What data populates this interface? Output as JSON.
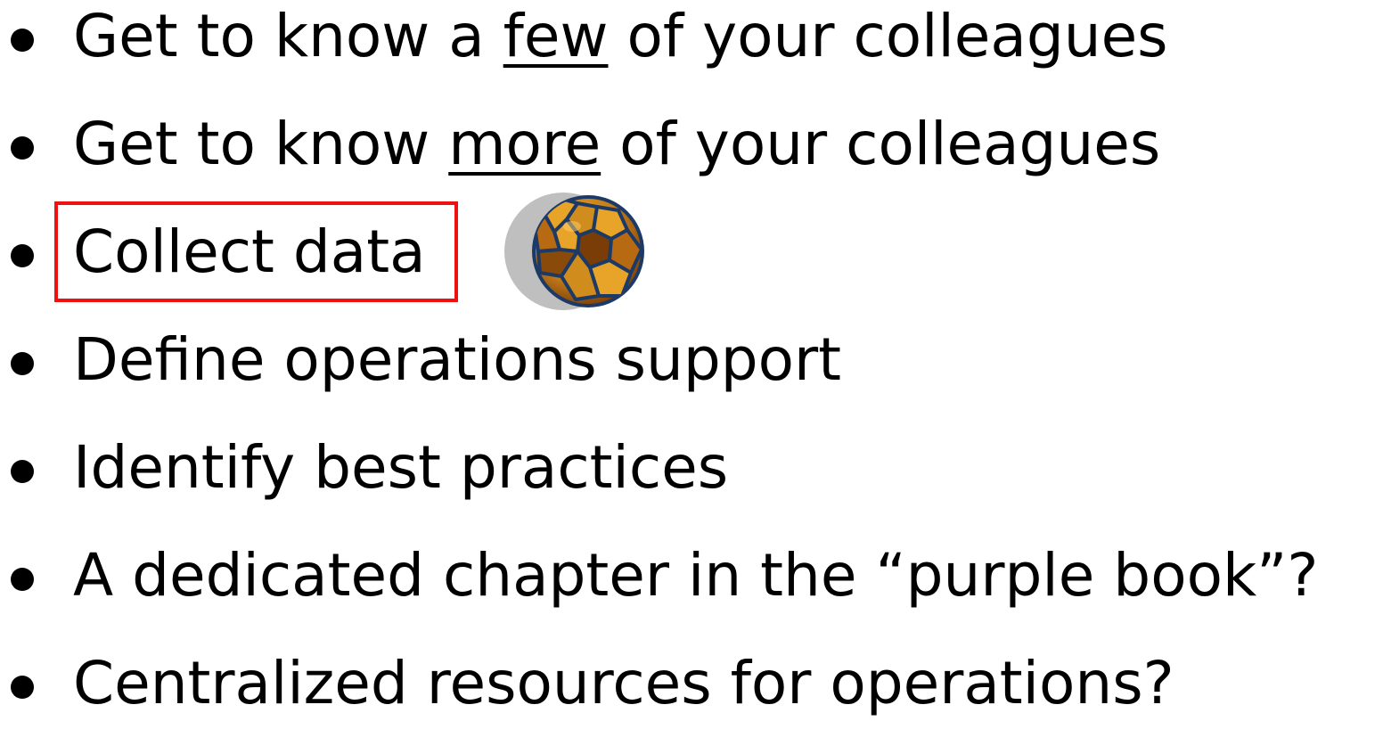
{
  "bullets": [
    {
      "pre": "Get to know a ",
      "emph": "few",
      "post": " of your colleagues"
    },
    {
      "pre": "Get to know ",
      "emph": "more",
      "post": " of your colleagues"
    },
    {
      "text": "Collect data"
    },
    {
      "text": "Define operations support"
    },
    {
      "text": "Identify best practices"
    },
    {
      "text": "A dedicated chapter in the “purple book”?"
    },
    {
      "text": "Centralized resources for operations?"
    }
  ],
  "icons": {
    "ball": "soccer-ball-icon"
  },
  "colors": {
    "highlight": "#ee1111",
    "ball_dark": "#8a4a0a",
    "ball_light": "#e0a020",
    "ball_outline": "#1d3a66",
    "shadow": "#bfbfbf"
  }
}
